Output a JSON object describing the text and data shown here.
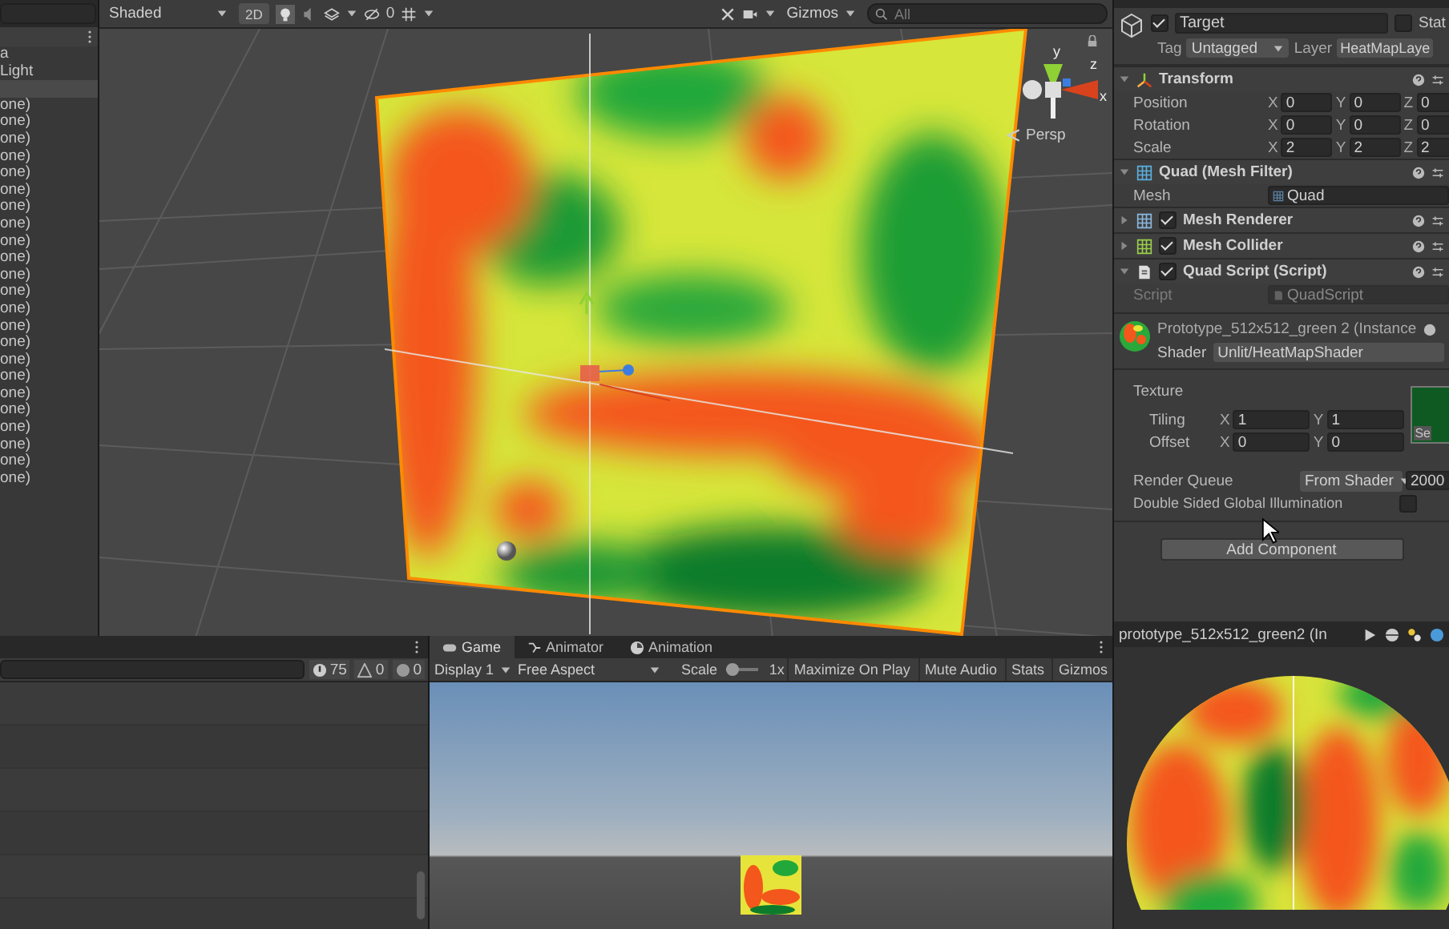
{
  "hierarchy": {
    "items": [
      {
        "label": "a"
      },
      {
        "label": "Light"
      },
      {
        "label": "one)"
      },
      {
        "label": "one)"
      },
      {
        "label": "one)"
      },
      {
        "label": "one)"
      },
      {
        "label": "one)"
      },
      {
        "label": "one)"
      },
      {
        "label": "one)"
      },
      {
        "label": "one)"
      },
      {
        "label": "one)"
      },
      {
        "label": "one)"
      },
      {
        "label": "one)"
      },
      {
        "label": "one)"
      },
      {
        "label": "one)"
      },
      {
        "label": "one)"
      },
      {
        "label": "one)"
      },
      {
        "label": "one)"
      },
      {
        "label": "one)"
      },
      {
        "label": "one)"
      },
      {
        "label": "one)"
      },
      {
        "label": "one)"
      },
      {
        "label": "one)"
      },
      {
        "label": "one)"
      },
      {
        "label": "one)"
      }
    ]
  },
  "scene_toolbar": {
    "shading_mode": "Shaded",
    "mode_2d": "2D",
    "hidden_count": "0",
    "gizmos": "Gizmos",
    "search": {
      "placeholder": "All"
    }
  },
  "scene": {
    "axes": [
      {
        "kind": "y",
        "label": "y"
      },
      {
        "kind": "z",
        "label": "z"
      },
      {
        "kind": "x",
        "label": "x"
      }
    ],
    "projection": "Persp"
  },
  "inspector": {
    "object": {
      "active": true,
      "name": "Target",
      "static": false,
      "static_label": "Stat",
      "tag_label": "Tag",
      "tag": "Untagged",
      "layer_label": "Layer",
      "layer": "HeatMapLaye"
    },
    "components": [
      {
        "kind": "transform",
        "title": "Transform",
        "expanded": true,
        "rows": [
          {
            "label": "Position",
            "values": [
              {
                "axis": "X",
                "value": "0"
              },
              {
                "axis": "Y",
                "value": "0"
              },
              {
                "axis": "Z",
                "value": "0"
              }
            ]
          },
          {
            "label": "Rotation",
            "values": [
              {
                "axis": "X",
                "value": "0"
              },
              {
                "axis": "Y",
                "value": "0"
              },
              {
                "axis": "Z",
                "value": "0"
              }
            ]
          },
          {
            "label": "Scale",
            "values": [
              {
                "axis": "X",
                "value": "2"
              },
              {
                "axis": "Y",
                "value": "2"
              },
              {
                "axis": "Z",
                "value": "2"
              }
            ]
          }
        ]
      },
      {
        "kind": "filter",
        "title": "Quad (Mesh Filter)",
        "expanded": true,
        "field_label": "Mesh",
        "field_value": "Quad"
      },
      {
        "kind": "renderer",
        "title": "Mesh Renderer",
        "expanded": false,
        "enabled": true
      },
      {
        "kind": "collider",
        "title": "Mesh Collider",
        "expanded": false,
        "enabled": true
      },
      {
        "kind": "script",
        "title": "Quad Script (Script)",
        "expanded": true,
        "enabled": true,
        "field_label": "Script",
        "field_value": "QuadScript"
      }
    ],
    "material": {
      "name": "Prototype_512x512_green 2 (Instance",
      "shader_label": "Shader",
      "shader": "Unlit/HeatMapShader",
      "texture_label": "Texture",
      "rows": [
        {
          "label": "Tiling",
          "values": [
            {
              "axis": "X",
              "value": "1"
            },
            {
              "axis": "Y",
              "value": "1"
            }
          ]
        },
        {
          "label": "Offset",
          "values": [
            {
              "axis": "X",
              "value": "0"
            },
            {
              "axis": "Y",
              "value": "0"
            }
          ]
        }
      ],
      "select_label": "Se",
      "render_queue_label": "Render Queue",
      "render_queue_mode": "From Shader",
      "render_queue_value": "2000",
      "double_sided_label": "Double Sided Global Illumination",
      "double_sided": false
    },
    "add_component": "Add Component",
    "preview": {
      "title": "prototype_512x512_green2 (In"
    }
  },
  "console": {
    "counts": [
      {
        "kind": "info",
        "value": "75"
      },
      {
        "kind": "warning",
        "value": "0"
      },
      {
        "kind": "error",
        "value": "0"
      }
    ]
  },
  "game": {
    "tabs": [
      {
        "kind": "game",
        "label": "Game",
        "selected": true
      },
      {
        "kind": "animator",
        "label": "Animator",
        "selected": false
      },
      {
        "kind": "animation",
        "label": "Animation",
        "selected": false
      }
    ],
    "display": "Display 1",
    "aspect": "Free Aspect",
    "scale_label": "Scale",
    "scale": {
      "level": 0.2
    },
    "scale_value": "1x",
    "buttons": [
      "Maximize On Play",
      "Mute Audio",
      "Stats",
      "Gizmos"
    ]
  }
}
